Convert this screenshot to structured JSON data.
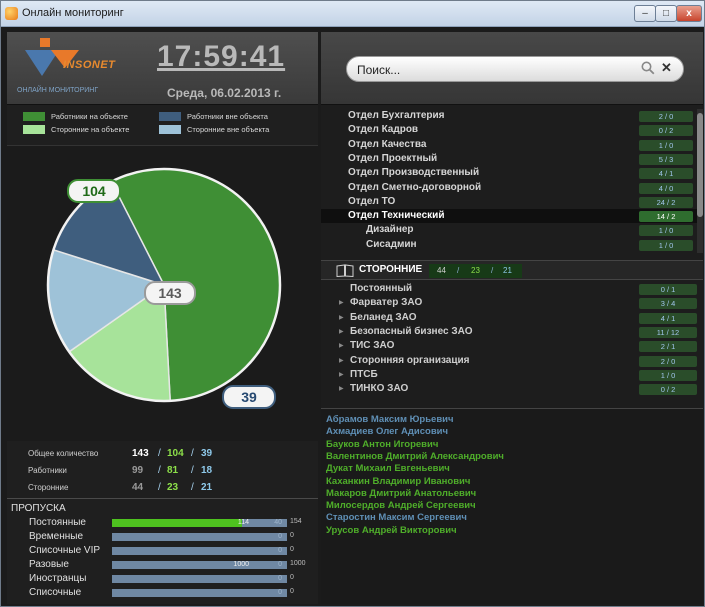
{
  "window": {
    "title": "Онлайн мониторинг"
  },
  "header": {
    "logo_text": "INSONET",
    "logo_sub": "ОНЛАЙН МОНИТОРИНГ",
    "clock": "17:59:41",
    "date": "Среда, 06.02.2013 г."
  },
  "legend": [
    {
      "label": "Работники на объекте",
      "color": "#3f8f35"
    },
    {
      "label": "Работники вне объекта",
      "color": "#3f5e7e"
    },
    {
      "label": "Сторонние на объекте",
      "color": "#a7e39a"
    },
    {
      "label": "Сторонние вне объекта",
      "color": "#9ec2d8"
    }
  ],
  "chart_data": {
    "type": "pie",
    "slices": [
      {
        "label": "Работники на объекте",
        "value": 81,
        "color": "#3f8f35"
      },
      {
        "label": "Сторонние на объекте",
        "value": 23,
        "color": "#a7e39a"
      },
      {
        "label": "Сторонние вне объекта",
        "value": 21,
        "color": "#9ec2d8"
      },
      {
        "label": "Работники вне объекта",
        "value": 18,
        "color": "#3f5e7e"
      }
    ],
    "callouts": {
      "top": "104",
      "center": "143",
      "bottom": "39"
    }
  },
  "stats": [
    {
      "label": "Общее количество",
      "total": "143",
      "on_site": "104",
      "off_site": "39"
    },
    {
      "label": "Работники",
      "total": "99",
      "on_site": "81",
      "off_site": "18"
    },
    {
      "label": "Сторонние",
      "total": "44",
      "on_site": "23",
      "off_site": "21"
    }
  ],
  "passes": {
    "title": "ПРОПУСКА",
    "rows": [
      {
        "label": "Постоянные",
        "fill": 0.74,
        "a": "114",
        "b": "40",
        "end": "154"
      },
      {
        "label": "Временные",
        "fill": 0,
        "a": "",
        "b": "0",
        "end": "0"
      },
      {
        "label": "Списочные VIP",
        "fill": 0,
        "a": "",
        "b": "0",
        "end": "0"
      },
      {
        "label": "Разовые",
        "fill": 0,
        "a": "1000",
        "b": "0",
        "end": "1000"
      },
      {
        "label": "Иностранцы",
        "fill": 0,
        "a": "",
        "b": "0",
        "end": "0"
      },
      {
        "label": "Списочные",
        "fill": 0,
        "a": "",
        "b": "0",
        "end": "0"
      }
    ]
  },
  "search": {
    "placeholder": "Поиск..."
  },
  "departments": [
    {
      "name": "Отдел Бухгалтерия",
      "a": "2",
      "b": "0"
    },
    {
      "name": "Отдел Кадров",
      "a": "0",
      "b": "2"
    },
    {
      "name": "Отдел Качества",
      "a": "1",
      "b": "0"
    },
    {
      "name": "Отдел Проектный",
      "a": "5",
      "b": "3"
    },
    {
      "name": "Отдел Производственный",
      "a": "4",
      "b": "1"
    },
    {
      "name": "Отдел Сметно-договорной",
      "a": "4",
      "b": "0"
    },
    {
      "name": "Отдел ТО",
      "a": "24",
      "b": "2"
    },
    {
      "name": "Отдел Технический",
      "a": "14",
      "b": "2",
      "selected": true
    },
    {
      "name": "Дизайнер",
      "a": "1",
      "b": "0",
      "sub": true
    },
    {
      "name": "Сисадмин",
      "a": "1",
      "b": "0",
      "sub": true
    }
  ],
  "external": {
    "title": "СТОРОННИЕ",
    "total": "44",
    "on_site": "23",
    "off_site": "21",
    "orgs": [
      {
        "name": "Постоянный",
        "a": "0",
        "b": "1",
        "arrow": false
      },
      {
        "name": "Фарватер ЗАО",
        "a": "3",
        "b": "4",
        "arrow": true
      },
      {
        "name": "Беланед ЗАО",
        "a": "4",
        "b": "1",
        "arrow": true
      },
      {
        "name": "Безопасный бизнес ЗАО",
        "a": "11",
        "b": "12",
        "arrow": true
      },
      {
        "name": "ТИС ЗАО",
        "a": "2",
        "b": "1",
        "arrow": true
      },
      {
        "name": "Сторонняя организация",
        "a": "2",
        "b": "0",
        "arrow": true
      },
      {
        "name": "ПТСБ",
        "a": "1",
        "b": "0",
        "arrow": true
      },
      {
        "name": "ТИНКО ЗАО",
        "a": "0",
        "b": "2",
        "arrow": true
      }
    ]
  },
  "people": [
    {
      "name": "Абрамов Максим Юрьевич",
      "color": "#5f8fb5"
    },
    {
      "name": "Ахмадиев Олег Адисович",
      "color": "#5f8fb5"
    },
    {
      "name": "Бауков Антон Игоревич",
      "color": "#4fae2a"
    },
    {
      "name": "Валентинов Дмитрий Александрович",
      "color": "#4fae2a"
    },
    {
      "name": "Дукат Михаил Евгеньевич",
      "color": "#4fae2a"
    },
    {
      "name": "Каханкин Владимир  Иванович",
      "color": "#4fae2a"
    },
    {
      "name": "Макаров Дмитрий Анатольевич",
      "color": "#4fae2a"
    },
    {
      "name": "Милосердов Андрей Сергеевич",
      "color": "#4fae2a"
    },
    {
      "name": "Старостин Максим Сергеевич",
      "color": "#5f8fb5"
    },
    {
      "name": "Урусов Андрей Викторович",
      "color": "#4fae2a"
    }
  ]
}
